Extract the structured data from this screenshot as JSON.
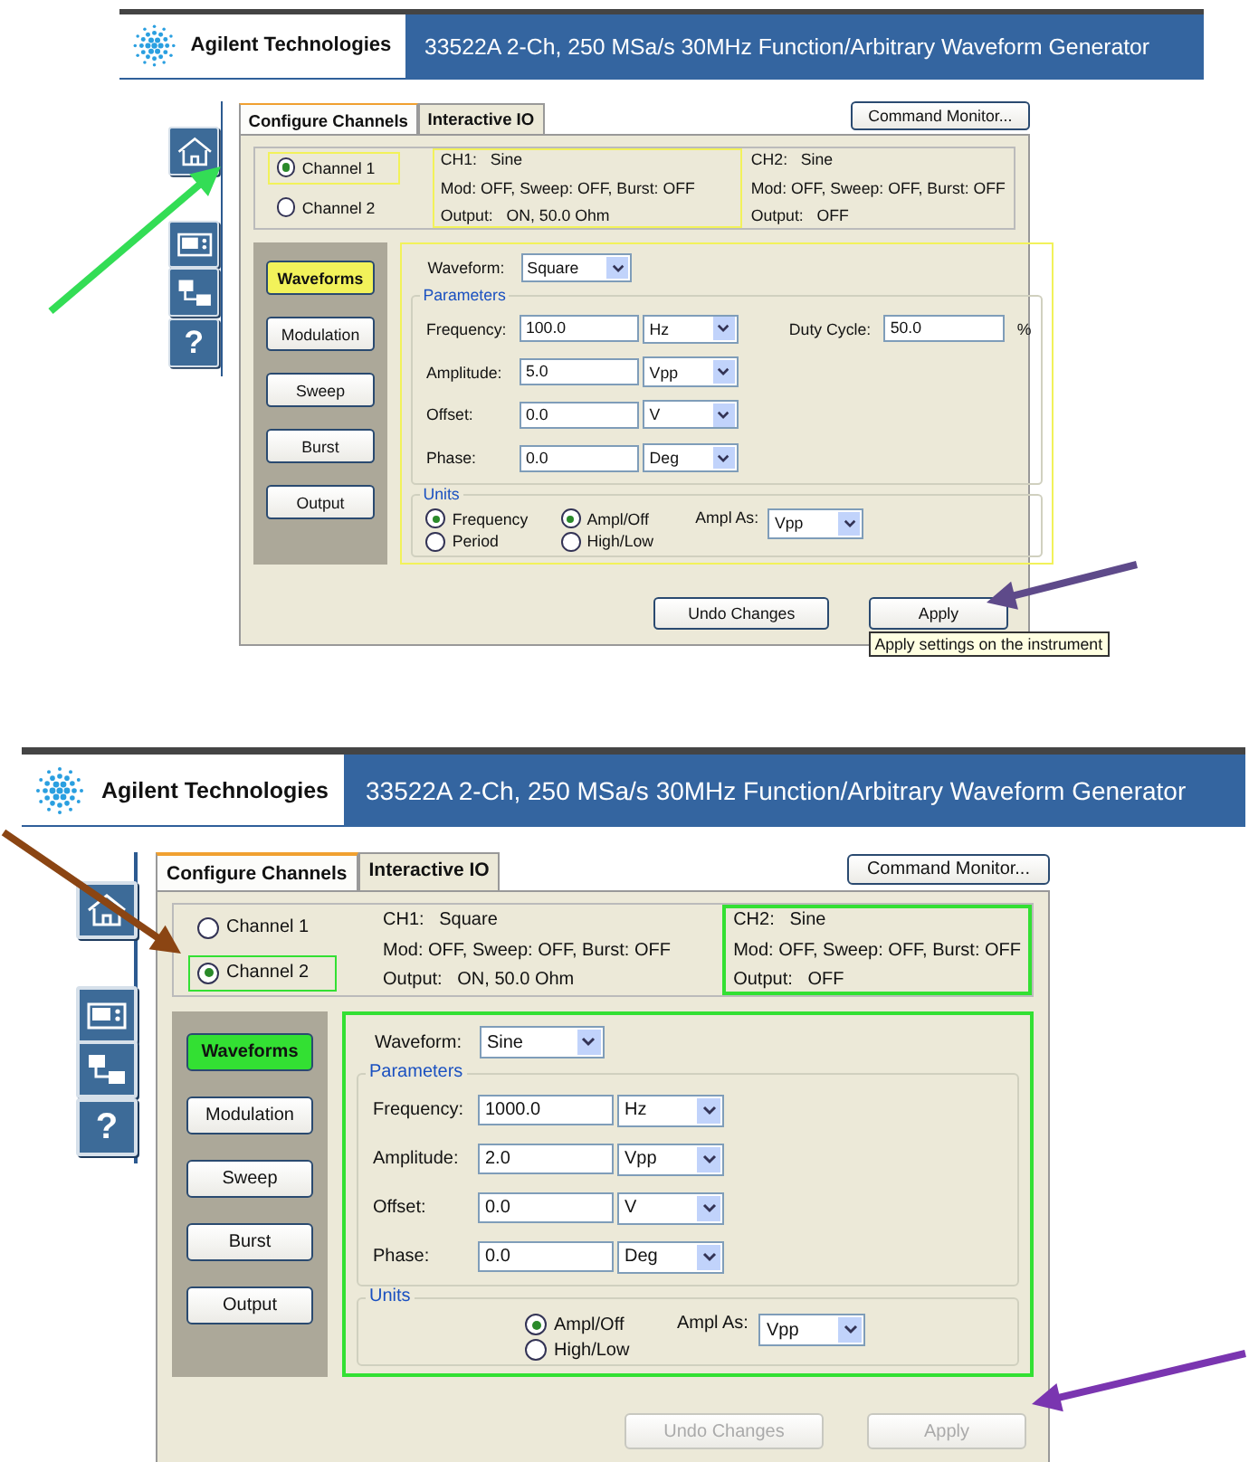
{
  "screens": [
    {
      "brand": "Agilent Technologies",
      "title": "33522A 2-Ch, 250 MSa/s 30MHz Function/Arbitrary Waveform Generator",
      "color": "#f2f25a",
      "side_icons": [
        {
          "kind": "home"
        },
        {
          "kind": "instrument"
        },
        {
          "kind": "network"
        },
        {
          "kind": "help",
          "label": "?"
        }
      ],
      "tabs": [
        {
          "label": "Configure Channels",
          "selected": true
        },
        {
          "label": "Interactive IO",
          "selected": false
        }
      ],
      "command_monitor": "Command Monitor...",
      "channels": [
        {
          "label": "Channel 1",
          "selected": true,
          "status": [
            "CH1:   Sine",
            "Mod: OFF, Sweep: OFF, Burst: OFF",
            "Output:   ON, 50.0 Ohm"
          ]
        },
        {
          "label": "Channel 2",
          "selected": false,
          "status": [
            "CH2:   Sine",
            "Mod: OFF, Sweep: OFF, Burst: OFF",
            "Output:   OFF"
          ]
        }
      ],
      "sections": [
        {
          "label": "Waveforms",
          "selected": true
        },
        {
          "label": "Modulation",
          "selected": false
        },
        {
          "label": "Sweep",
          "selected": false
        },
        {
          "label": "Burst",
          "selected": false
        },
        {
          "label": "Output",
          "selected": false
        }
      ],
      "waveform": {
        "label": "Waveform:",
        "value": "Square"
      },
      "parameters": {
        "title": "Parameters",
        "rows": [
          {
            "label": "Frequency:",
            "value": "100.0",
            "unit": "Hz"
          },
          {
            "label": "Amplitude:",
            "value": "5.0",
            "unit": "Vpp"
          },
          {
            "label": "Offset:",
            "value": "0.0",
            "unit": "V"
          },
          {
            "label": "Phase:",
            "value": "0.0",
            "unit": "Deg"
          }
        ],
        "duty_cycle": {
          "label": "Duty Cycle:",
          "value": "50.0",
          "unit": "%"
        }
      },
      "units": {
        "title": "Units",
        "frequency_group": [
          {
            "label": "Frequency",
            "selected": true
          },
          {
            "label": "Period",
            "selected": false
          }
        ],
        "amplitude_group": [
          {
            "label": "Ampl/Off",
            "selected": true
          },
          {
            "label": "High/Low",
            "selected": false
          }
        ],
        "ampl_as": {
          "label": "Ampl As:",
          "value": "Vpp"
        }
      },
      "buttons": [
        {
          "label": "Undo Changes",
          "disabled": false
        },
        {
          "label": "Apply",
          "disabled": false,
          "tooltip": "Apply settings on the instrument"
        }
      ]
    },
    {
      "brand": "Agilent Technologies",
      "title": "33522A 2-Ch, 250 MSa/s 30MHz Function/Arbitrary Waveform Generator",
      "color": "#33e033",
      "side_icons": [
        {
          "kind": "home"
        },
        {
          "kind": "instrument"
        },
        {
          "kind": "network"
        },
        {
          "kind": "help",
          "label": "?"
        }
      ],
      "tabs": [
        {
          "label": "Configure Channels",
          "selected": true
        },
        {
          "label": "Interactive IO",
          "selected": false
        }
      ],
      "command_monitor": "Command Monitor...",
      "channels": [
        {
          "label": "Channel 1",
          "selected": false,
          "status": [
            "CH1:   Square",
            "Mod: OFF, Sweep: OFF, Burst: OFF",
            "Output:   ON, 50.0 Ohm"
          ]
        },
        {
          "label": "Channel 2",
          "selected": true,
          "status": [
            "CH2:   Sine",
            "Mod: OFF, Sweep: OFF, Burst: OFF",
            "Output:   OFF"
          ]
        }
      ],
      "sections": [
        {
          "label": "Waveforms",
          "selected": true
        },
        {
          "label": "Modulation",
          "selected": false
        },
        {
          "label": "Sweep",
          "selected": false
        },
        {
          "label": "Burst",
          "selected": false
        },
        {
          "label": "Output",
          "selected": false
        }
      ],
      "waveform": {
        "label": "Waveform:",
        "value": "Sine"
      },
      "parameters": {
        "title": "Parameters",
        "rows": [
          {
            "label": "Frequency:",
            "value": "1000.0",
            "unit": "Hz"
          },
          {
            "label": "Amplitude:",
            "value": "2.0",
            "unit": "Vpp"
          },
          {
            "label": "Offset:",
            "value": "0.0",
            "unit": "V"
          },
          {
            "label": "Phase:",
            "value": "0.0",
            "unit": "Deg"
          }
        ]
      },
      "units": {
        "title": "Units",
        "amplitude_group": [
          {
            "label": "Ampl/Off",
            "selected": true
          },
          {
            "label": "High/Low",
            "selected": false
          }
        ],
        "ampl_as": {
          "label": "Ampl As:",
          "value": "Vpp"
        }
      },
      "buttons": [
        {
          "label": "Undo Changes",
          "disabled": true
        },
        {
          "label": "Apply",
          "disabled": true
        }
      ]
    }
  ],
  "arrows": [
    {
      "color": "#33dd55"
    },
    {
      "color": "#5e4a8a"
    },
    {
      "color": "#8b4513"
    },
    {
      "color": "#7a35b0"
    }
  ]
}
